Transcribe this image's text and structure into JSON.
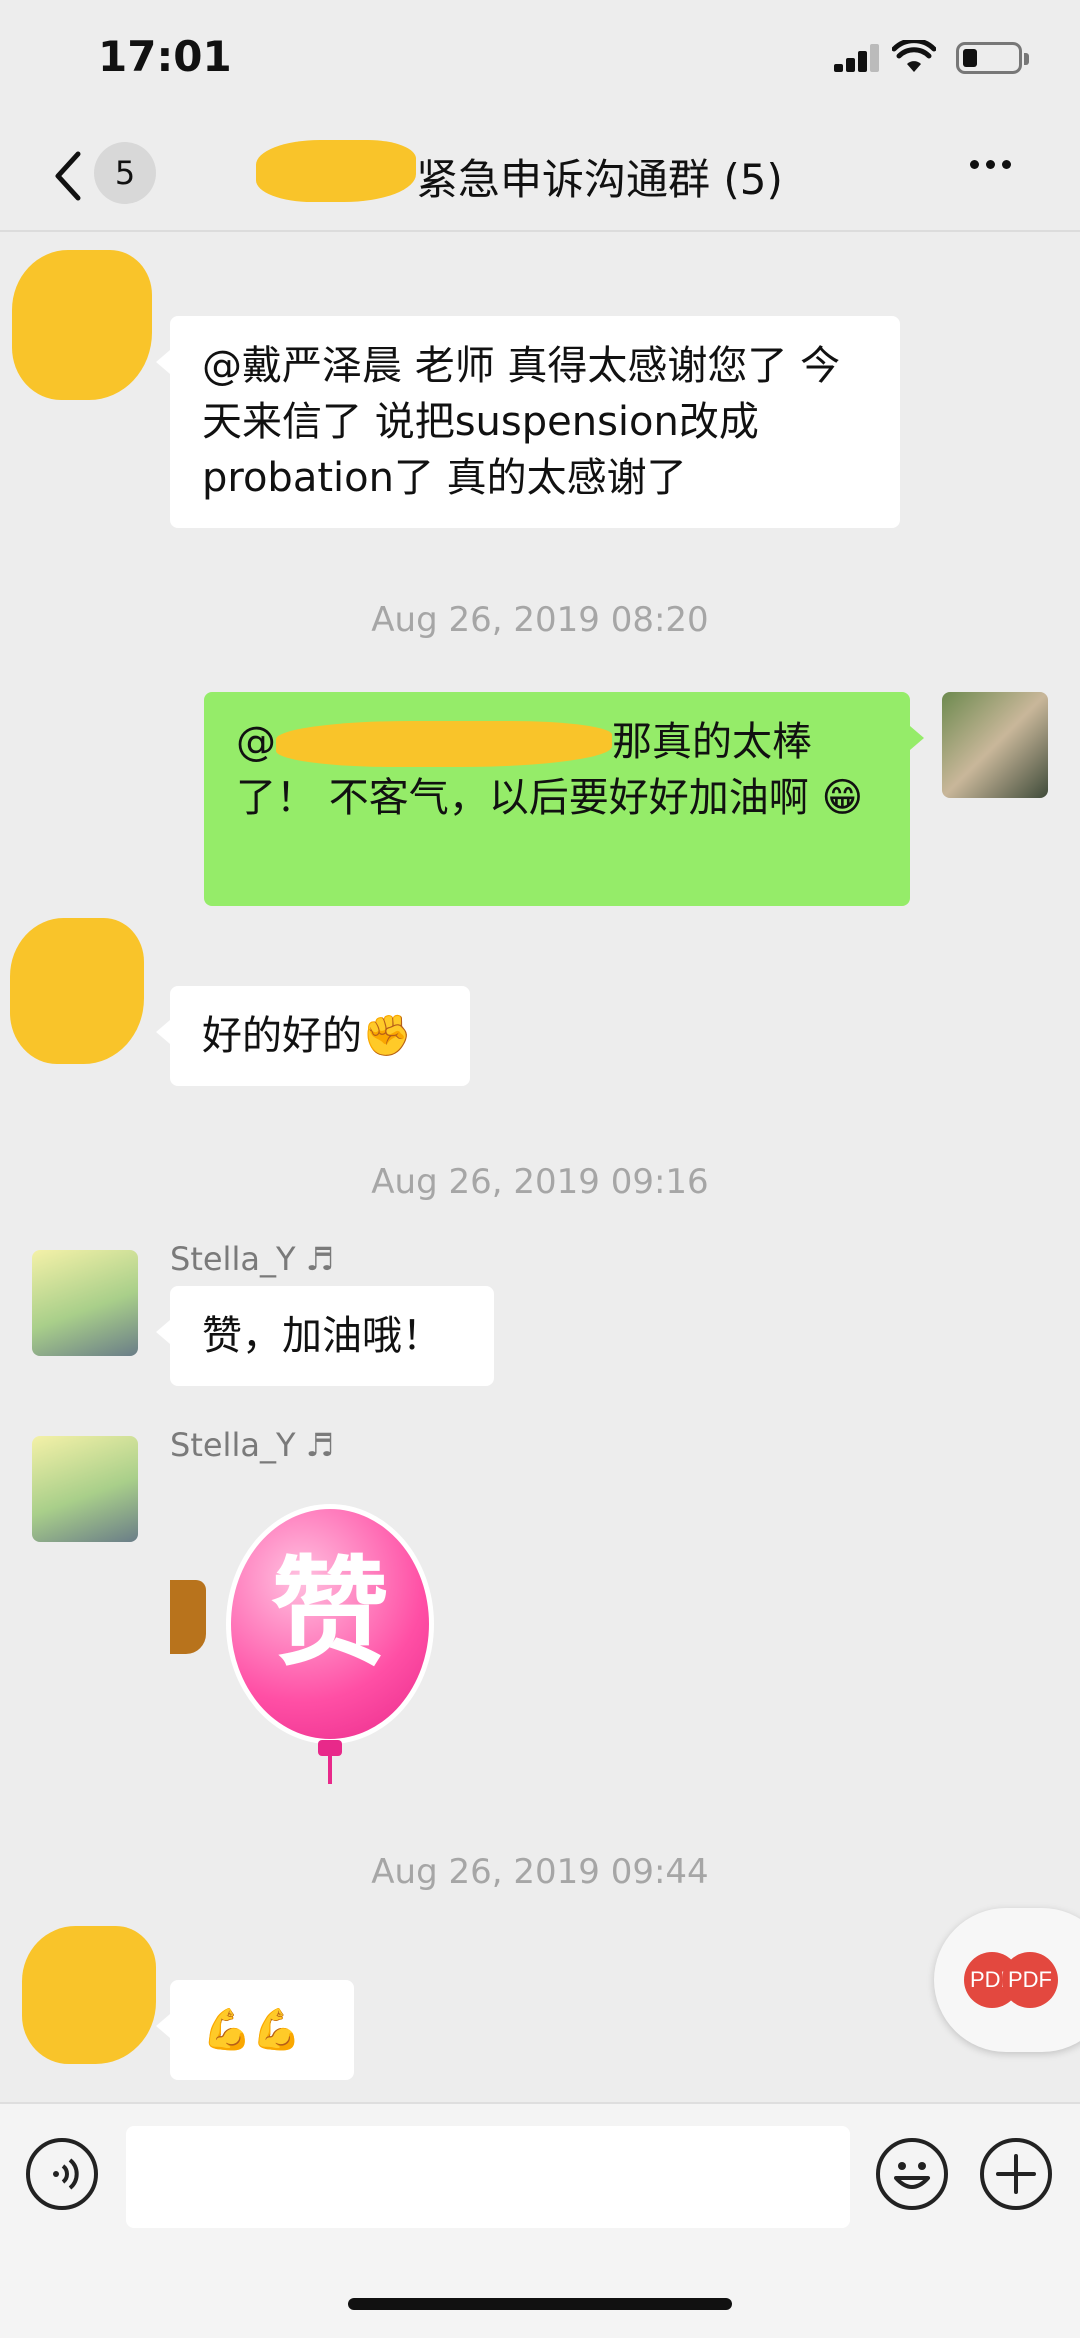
{
  "status_bar": {
    "time": "17:01"
  },
  "nav": {
    "back_badge": "5",
    "title": "紧急申诉沟通群 (5)",
    "icons": [
      "chevron-left-icon",
      "more-icon"
    ]
  },
  "messages": [
    {
      "side": "left",
      "text": "@戴严泽晨 老师 真得太感谢您了 今天来信了 说把suspension改成probation了 真的太感谢了"
    },
    {
      "timestamp": "Aug 26, 2019 08:20"
    },
    {
      "side": "right",
      "prefix": "@",
      "text": "那真的太棒了！ 不客气，以后要好好加油啊",
      "emoji": "😁"
    },
    {
      "side": "left",
      "text": "好的好的",
      "emoji": "✊"
    },
    {
      "timestamp": "Aug 26, 2019 09:16"
    },
    {
      "side": "left",
      "sender": "Stella_Y",
      "sender_icon": "♬",
      "text": "赞，加油哦！"
    },
    {
      "side": "left",
      "sender": "Stella_Y",
      "sender_icon": "♬",
      "sticker_text": "赞"
    },
    {
      "timestamp": "Aug 26, 2019 09:44"
    },
    {
      "side": "left",
      "emoji": "💪💪"
    }
  ],
  "floating": {
    "pdf_label_1": "PDF",
    "pdf_label_2": "PDF"
  },
  "input_bar": {
    "icons": [
      "voice-icon",
      "emoji-icon",
      "plus-icon"
    ],
    "text_value": ""
  },
  "colors": {
    "outgoing_bubble": "#95ec69",
    "incoming_bubble": "#ffffff",
    "background": "#ededed"
  }
}
